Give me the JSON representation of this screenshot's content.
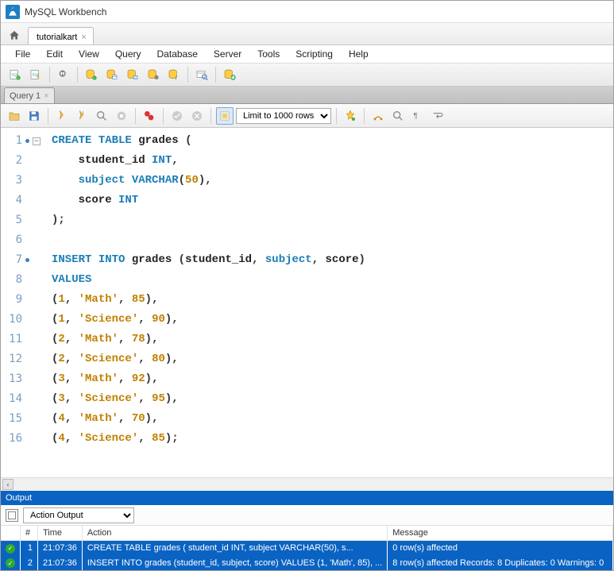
{
  "app": {
    "title": "MySQL Workbench"
  },
  "fileTab": {
    "name": "tutorialkart"
  },
  "menu": [
    "File",
    "Edit",
    "View",
    "Query",
    "Database",
    "Server",
    "Tools",
    "Scripting",
    "Help"
  ],
  "queryTab": {
    "name": "Query 1"
  },
  "limit": {
    "selected": "Limit to 1000 rows"
  },
  "code": {
    "lines": [
      {
        "n": 1,
        "dot": true,
        "fold": true,
        "html": "<span class='kw'>CREATE</span> <span class='kw'>TABLE</span> grades <span class='pun'>(</span>"
      },
      {
        "n": 2,
        "html": "    student_id <span class='ty'>INT</span><span class='pun'>,</span>"
      },
      {
        "n": 3,
        "html": "    <span class='id'>subject</span> <span class='ty'>VARCHAR</span><span class='pun'>(</span><span class='num'>50</span><span class='pun'>),</span>"
      },
      {
        "n": 4,
        "html": "    score <span class='ty'>INT</span>"
      },
      {
        "n": 5,
        "html": "<span class='pun'>);</span>"
      },
      {
        "n": 6,
        "html": ""
      },
      {
        "n": 7,
        "dot": true,
        "html": "<span class='kw'>INSERT</span> <span class='kw'>INTO</span> grades <span class='pun'>(</span>student_id<span class='pun'>,</span> <span class='id'>subject</span><span class='pun'>,</span> score<span class='pun'>)</span>"
      },
      {
        "n": 8,
        "html": "<span class='kw'>VALUES</span>"
      },
      {
        "n": 9,
        "html": "<span class='pun'>(</span><span class='num'>1</span><span class='pun'>,</span> <span class='str'>'Math'</span><span class='pun'>,</span> <span class='num'>85</span><span class='pun'>),</span>"
      },
      {
        "n": 10,
        "html": "<span class='pun'>(</span><span class='num'>1</span><span class='pun'>,</span> <span class='str'>'Science'</span><span class='pun'>,</span> <span class='num'>90</span><span class='pun'>),</span>"
      },
      {
        "n": 11,
        "html": "<span class='pun'>(</span><span class='num'>2</span><span class='pun'>,</span> <span class='str'>'Math'</span><span class='pun'>,</span> <span class='num'>78</span><span class='pun'>),</span>"
      },
      {
        "n": 12,
        "html": "<span class='pun'>(</span><span class='num'>2</span><span class='pun'>,</span> <span class='str'>'Science'</span><span class='pun'>,</span> <span class='num'>80</span><span class='pun'>),</span>"
      },
      {
        "n": 13,
        "html": "<span class='pun'>(</span><span class='num'>3</span><span class='pun'>,</span> <span class='str'>'Math'</span><span class='pun'>,</span> <span class='num'>92</span><span class='pun'>),</span>"
      },
      {
        "n": 14,
        "html": "<span class='pun'>(</span><span class='num'>3</span><span class='pun'>,</span> <span class='str'>'Science'</span><span class='pun'>,</span> <span class='num'>95</span><span class='pun'>),</span>"
      },
      {
        "n": 15,
        "html": "<span class='pun'>(</span><span class='num'>4</span><span class='pun'>,</span> <span class='str'>'Math'</span><span class='pun'>,</span> <span class='num'>70</span><span class='pun'>),</span>"
      },
      {
        "n": 16,
        "html": "<span class='pun'>(</span><span class='num'>4</span><span class='pun'>,</span> <span class='str'>'Science'</span><span class='pun'>,</span> <span class='num'>85</span><span class='pun'>);</span>"
      }
    ]
  },
  "output": {
    "title": "Output",
    "mode": "Action Output",
    "headers": {
      "num": "#",
      "time": "Time",
      "action": "Action",
      "message": "Message"
    },
    "rows": [
      {
        "n": "1",
        "time": "21:07:36",
        "action": "CREATE TABLE grades (     student_id INT,     subject VARCHAR(50),     s...",
        "message": "0 row(s) affected"
      },
      {
        "n": "2",
        "time": "21:07:36",
        "action": "INSERT INTO grades (student_id, subject, score) VALUES (1, 'Math', 85), ...",
        "message": "8 row(s) affected Records: 8  Duplicates: 0  Warnings: 0"
      }
    ]
  }
}
